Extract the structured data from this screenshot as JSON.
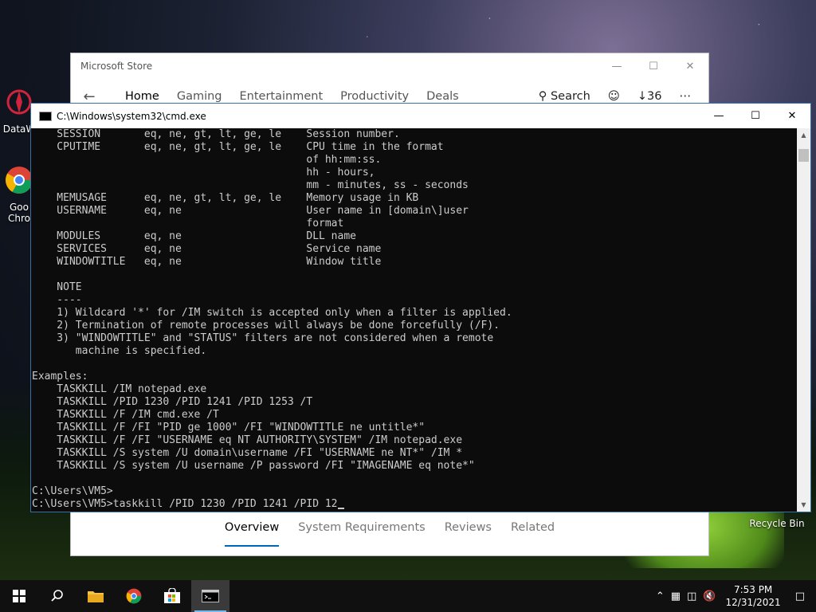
{
  "desktop": {
    "icons": [
      {
        "label": "DataW",
        "icon": "datawrapper-icon"
      },
      {
        "label_line1": "Goo",
        "label_line2": "Chro",
        "icon": "chrome-icon"
      },
      {
        "label": "Recycle Bin",
        "icon": "recycle-bin-icon"
      }
    ]
  },
  "store": {
    "title": "Microsoft Store",
    "nav": {
      "home": "Home",
      "gaming": "Gaming",
      "entertainment": "Entertainment",
      "productivity": "Productivity",
      "deals": "Deals",
      "search": "Search",
      "downloads_count": "36",
      "more": "⋯"
    },
    "bottom_tabs": {
      "overview": "Overview",
      "system_requirements": "System Requirements",
      "reviews": "Reviews",
      "related": "Related"
    },
    "accent": "#0067b8"
  },
  "cmd": {
    "title": "C:\\Windows\\system32\\cmd.exe",
    "lines": [
      "    SESSION       eq, ne, gt, lt, ge, le    Session number.",
      "    CPUTIME       eq, ne, gt, lt, ge, le    CPU time in the format",
      "                                            of hh:mm:ss.",
      "                                            hh - hours,",
      "                                            mm - minutes, ss - seconds",
      "    MEMUSAGE      eq, ne, gt, lt, ge, le    Memory usage in KB",
      "    USERNAME      eq, ne                    User name in [domain\\]user",
      "                                            format",
      "    MODULES       eq, ne                    DLL name",
      "    SERVICES      eq, ne                    Service name",
      "    WINDOWTITLE   eq, ne                    Window title",
      "",
      "    NOTE",
      "    ----",
      "    1) Wildcard '*' for /IM switch is accepted only when a filter is applied.",
      "    2) Termination of remote processes will always be done forcefully (/F).",
      "    3) \"WINDOWTITLE\" and \"STATUS\" filters are not considered when a remote",
      "       machine is specified.",
      "",
      "Examples:",
      "    TASKKILL /IM notepad.exe",
      "    TASKKILL /PID 1230 /PID 1241 /PID 1253 /T",
      "    TASKKILL /F /IM cmd.exe /T",
      "    TASKKILL /F /FI \"PID ge 1000\" /FI \"WINDOWTITLE ne untitle*\"",
      "    TASKKILL /F /FI \"USERNAME eq NT AUTHORITY\\SYSTEM\" /IM notepad.exe",
      "    TASKKILL /S system /U domain\\username /FI \"USERNAME ne NT*\" /IM *",
      "    TASKKILL /S system /U username /P password /FI \"IMAGENAME eq note*\"",
      "",
      "C:\\Users\\VM5>"
    ],
    "prompt": "C:\\Users\\VM5>",
    "current_input": "taskkill /PID 1230 /PID 1241 /PID 12"
  },
  "taskbar": {
    "apps": [
      "start-icon",
      "search-icon",
      "file-explorer-icon",
      "chrome-icon",
      "store-icon",
      "cmd-icon"
    ],
    "time": "7:53 PM",
    "date": "12/31/2021"
  }
}
